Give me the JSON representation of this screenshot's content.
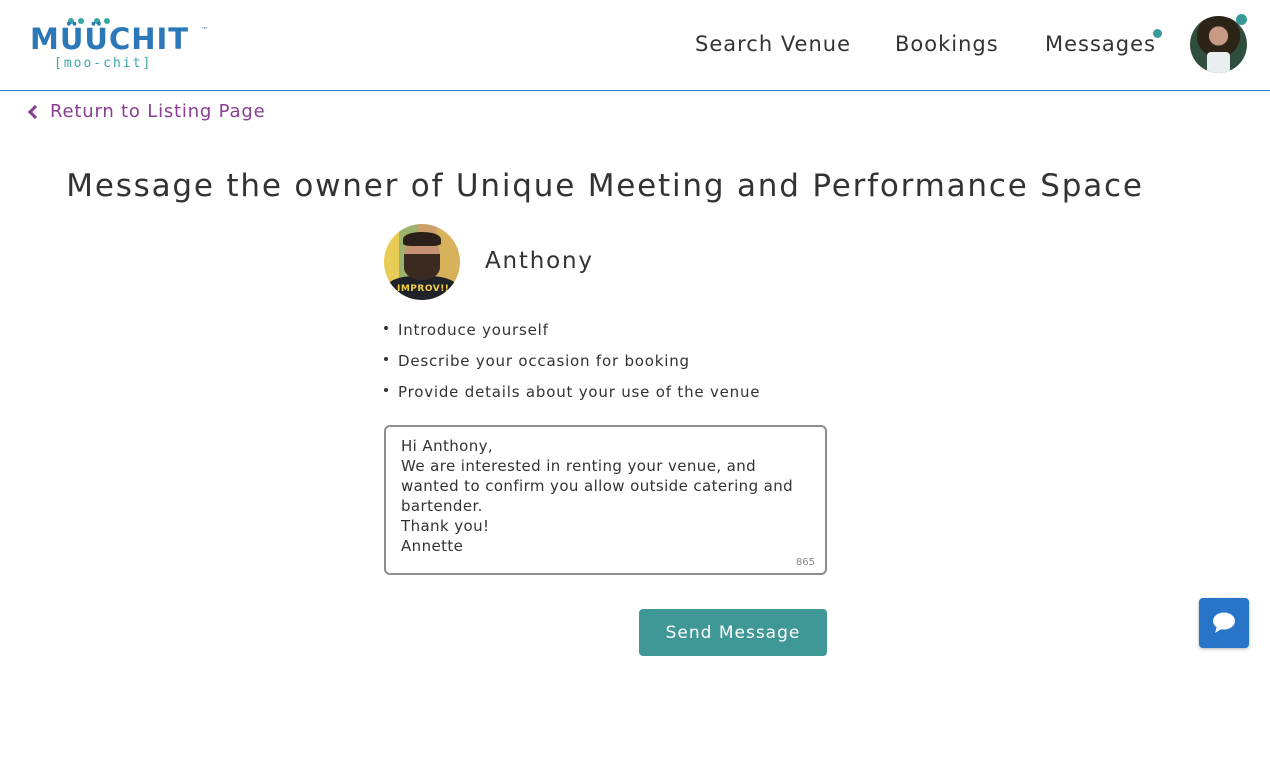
{
  "header": {
    "logo_text": "MÜÜCHIT",
    "logo_tm": "™",
    "logo_subtitle": "[moo-chit]",
    "nav": [
      {
        "label": "Search Venue"
      },
      {
        "label": "Bookings"
      },
      {
        "label": "Messages",
        "has_notification": true
      }
    ],
    "avatar_status": "online"
  },
  "back_link": {
    "label": "Return to Listing Page",
    "icon": "chevron-left-icon"
  },
  "main": {
    "title": "Message the owner of Unique Meeting and Performance Space",
    "owner": {
      "name": "Anthony",
      "avatar_shirt_text": "IMPROV!!"
    },
    "tips": [
      "Introduce yourself",
      "Describe your occasion for booking",
      "Provide details about your use of the venue"
    ],
    "message": {
      "value": "Hi Anthony,\nWe are interested in renting your venue, and wanted to confirm you allow outside catering and bartender.\nThank you!\nAnnette",
      "char_count": "865"
    },
    "send_label": "Send Message"
  },
  "colors": {
    "brand_blue": "#2b78b8",
    "brand_teal": "#3aa7a5",
    "link_purple": "#8a3b94",
    "button_teal": "#3f9896",
    "chat_blue": "#2874c9"
  },
  "chat_widget": {
    "icon": "chat-bubble-icon"
  }
}
